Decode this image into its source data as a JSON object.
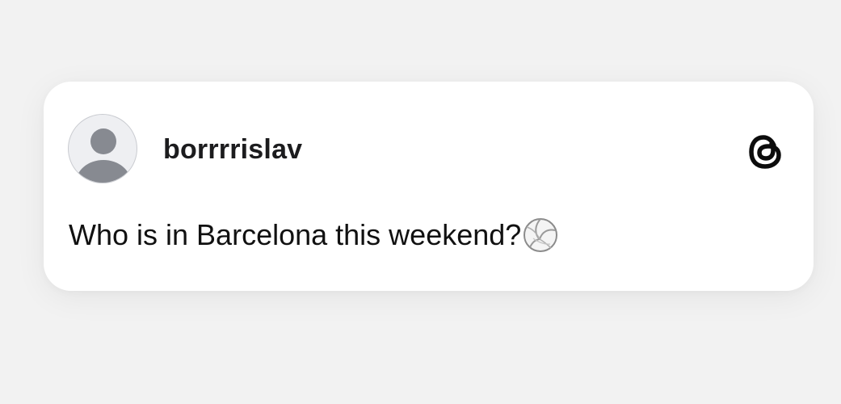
{
  "post": {
    "username": "borrrrislav",
    "text": "Who is in Barcelona this weekend?",
    "emoji_icon": "volleyball-icon",
    "avatar_icon": "default-avatar-icon",
    "brand_icon": "threads-logo-icon"
  }
}
